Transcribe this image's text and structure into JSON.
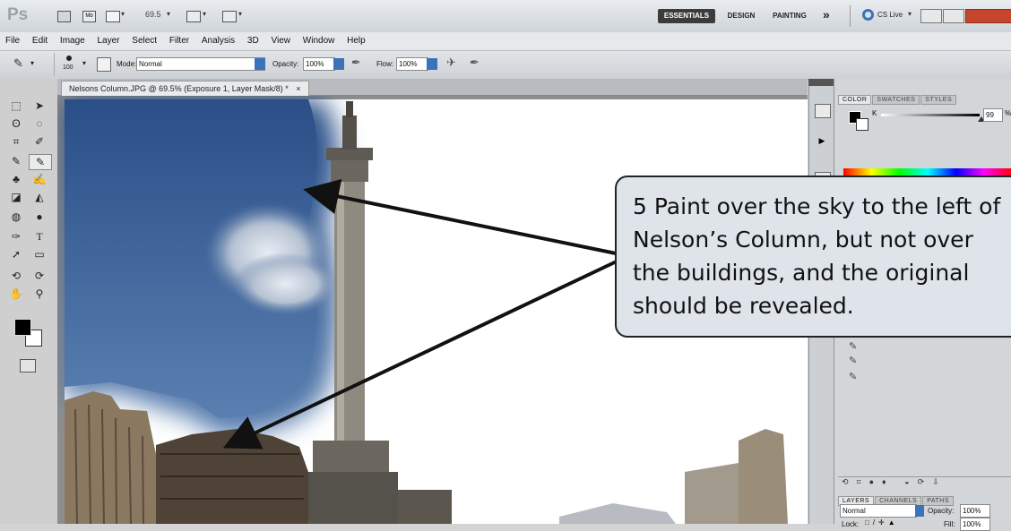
{
  "app": {
    "logo": "Ps",
    "zoom": "69.5",
    "workspaces": [
      "ESSENTIALS",
      "DESIGN",
      "PAINTING"
    ],
    "more": "»",
    "cs_live": "CS Live",
    "accent": "#3b73b9",
    "close_color": "#c8452d"
  },
  "menu": [
    "File",
    "Edit",
    "Image",
    "Layer",
    "Select",
    "Filter",
    "Analysis",
    "3D",
    "View",
    "Window",
    "Help"
  ],
  "options": {
    "brush_size": "100",
    "mode_label": "Mode:",
    "mode_value": "Normal",
    "opacity_label": "Opacity:",
    "opacity_value": "100%",
    "flow_label": "Flow:",
    "flow_value": "100%"
  },
  "document": {
    "tab_title": "Nelsons Column.JPG @ 69.5% (Exposure 1, Layer Mask/8) *",
    "close": "×"
  },
  "color_panel": {
    "tabs": [
      "COLOR",
      "SWATCHES",
      "STYLES"
    ],
    "channel": "K",
    "value": "99",
    "unit": "%"
  },
  "layers_panel": {
    "tabs": [
      "LAYERS",
      "CHANNELS",
      "PATHS"
    ],
    "blend_mode": "Normal",
    "opacity_label": "Opacity:",
    "opacity_value": "100%",
    "lock_label": "Lock:",
    "fill_label": "Fill:",
    "fill_value": "100%"
  },
  "callout": {
    "lines": [
      "5  Paint over the sky to the left of",
      "    Nelson’s Column, but not over",
      "    the buildings, and the original",
      "    should be revealed."
    ]
  }
}
